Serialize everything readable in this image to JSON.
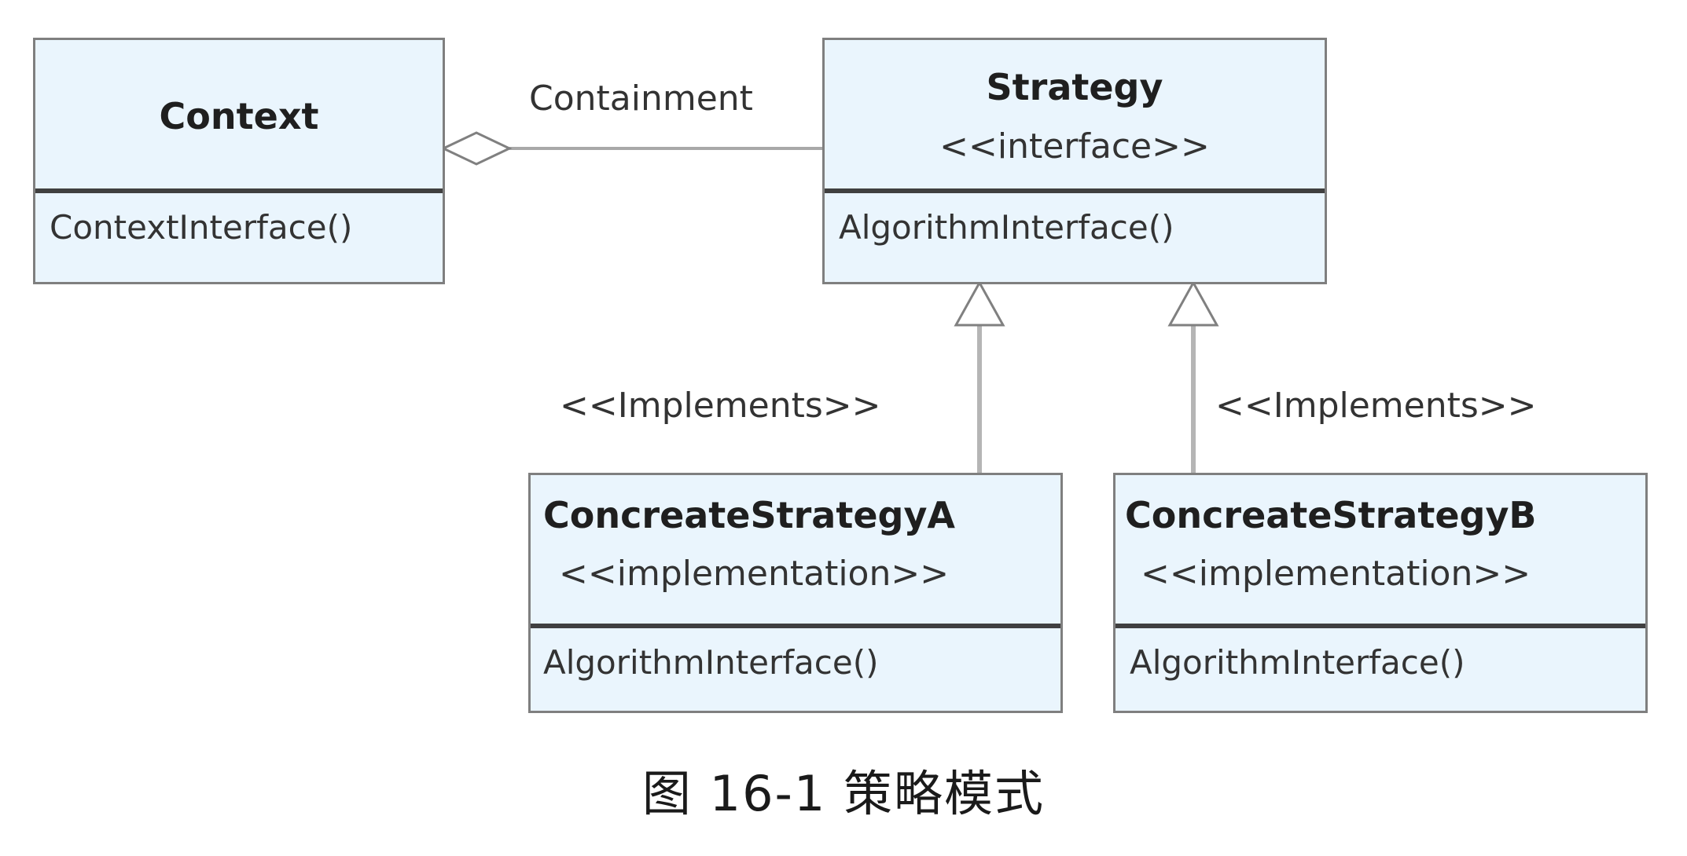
{
  "classes": {
    "context": {
      "name": "Context",
      "methods": [
        "ContextInterface()"
      ]
    },
    "strategy": {
      "name": "Strategy",
      "stereotype": "<<interface>>",
      "methods": [
        "AlgorithmInterface()"
      ]
    },
    "concrete_a": {
      "name": "ConcreateStrategyA",
      "stereotype": "<<implementation>>",
      "methods": [
        "AlgorithmInterface()"
      ]
    },
    "concrete_b": {
      "name": "ConcreateStrategyB",
      "stereotype": "<<implementation>>",
      "methods": [
        "AlgorithmInterface()"
      ]
    }
  },
  "relations": {
    "containment_label": "Containment",
    "implements_a_label": "<<Implements>>",
    "implements_b_label": "<<Implements>>"
  },
  "caption": "图 16-1 策略模式",
  "colors": {
    "box_fill": "#eaf5fd",
    "box_border": "#7f7f7f",
    "divider": "#404040",
    "connector": "#b0b0b0"
  }
}
